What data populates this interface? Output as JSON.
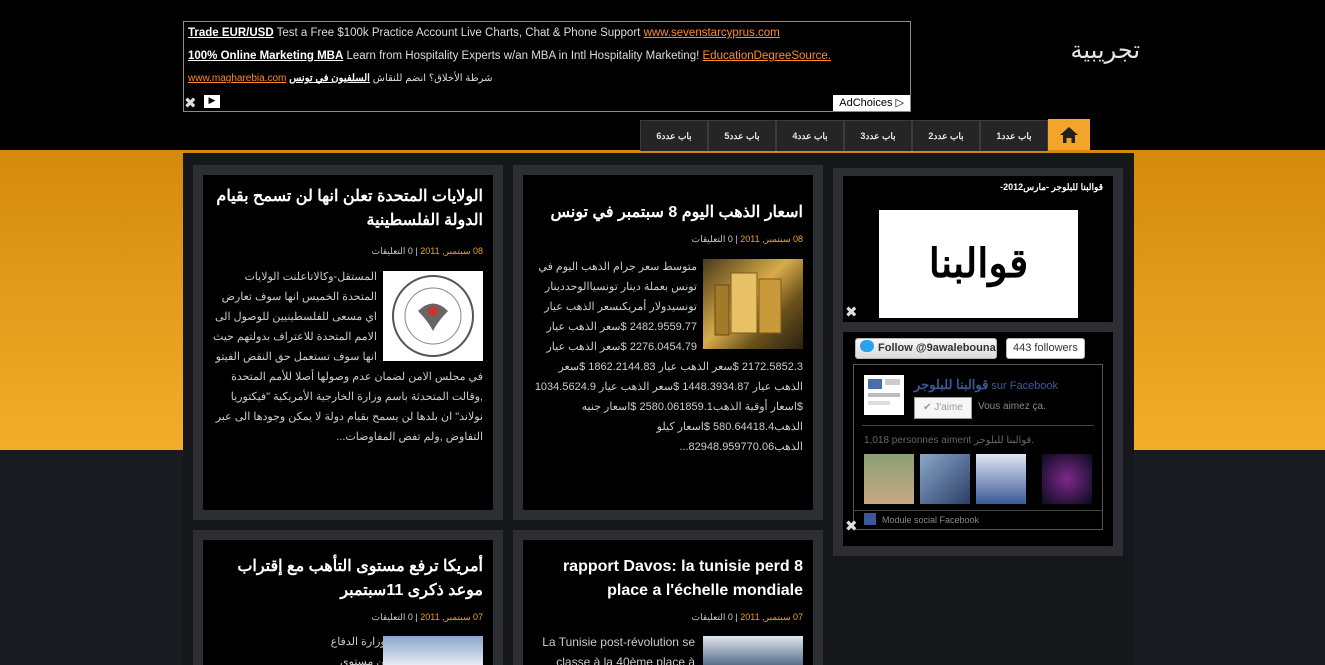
{
  "site": {
    "title": "تجريبية"
  },
  "ad": {
    "line1": {
      "title": "Trade EUR/USD",
      "text": " Test a Free $100k Practice Account Live Charts, Chat & Phone Support ",
      "url": "www.sevenstarcyprus.com"
    },
    "line2": {
      "title": "100% Online Marketing MBA",
      "text": " Learn from Hospitality Experts w/an MBA in Intl Hospitality Marketing! ",
      "url": "EducationDegreeSource."
    },
    "line3": {
      "title": "السلفيون في تونس",
      "text": " شرطة الأخلاق؟ انضم للنقاش ",
      "url": "www.magharebia.com"
    },
    "choices": "AdChoices ▷",
    "arrow": "▶"
  },
  "nav": {
    "home_icon": "home-icon",
    "tabs": [
      "باب عدد1",
      "باب عدد2",
      "باب عدد3",
      "باب عدد4",
      "باب عدد5",
      "باب عدد6"
    ]
  },
  "posts": [
    {
      "title": "الولايات المتحدة تعلن انها لن تسمح بقيام الدولة الفلسطينية",
      "date": "08 سبتمبر, 2011",
      "comments": "| 0 التعليقات",
      "thumb_text": "State of PALESTINE",
      "body": "المستقل-وكالاتاعلنت الولايات المتحدة الخميس انها سوف تعارض اي مسعى للفلسطينيين للوصول الى الامم المتحدة للاعتراف بدولتهم حيث انها سوف تستعمل حق النقض الفيتو في مجلس الامن لضمان عدم وصولها أصلا للأمم المتحدة ,وقالت المتحدثة باسم وزارة الخارجية الأمريكية \"فيكتوريا نولاند\" ان بلدها لن يسمح بقيام دولة لا يمكن وجودها الى عبر التفاوض ,ولم تفض المفاوضات..."
    },
    {
      "title": "اسعار الذهب اليوم 8 سبتمبر في تونس",
      "date": "08 سبتمبر, 2011",
      "comments": "| 0 التعليقات",
      "body": "متوسط سعر جرام الذهب اليوم في تونس بعملة دينار تونسياالوحددينار تونسيدولار أمريكىسعر الذهب عيار 2482.9559.77 $سعر الذهب عيار 2276.0454.79 $سعر الذهب عيار 2172.5852.3 $سعر الذهب عيار 1862.2144.83 $سعر الذهب عيار 1448.3934.87 $سعر الذهب عيار 1034.5624.9 $اسعار أوقية الذهب2580.061859.1 $اسعار جنيه الذهب580.64418.4 $اسعار كيلو الذهب82948.959770.06..."
    },
    {
      "title": "أمريكا ترفع مستوى التأهب مع إقتراب موعد ذكرى 11سبتمبر",
      "date": "07 سبتمبر, 2011",
      "comments": "| 0 التعليقات",
      "body": "المستقل-وكالاترفعت وزارة الدفاع الأمريكية (البنتاغون) من مستوى"
    },
    {
      "title": "rapport Davos: la tunisie perd 8 place a l'échelle mondiale",
      "date": "07 سبتمبر, 2011",
      "comments": "| 0 التعليقات",
      "body": "La Tunisie post-révolution se classe à la 40ème place à"
    }
  ],
  "sidebar": {
    "widget1": {
      "title": "قوالبنا للبلوجر -مارس2012-",
      "image_text": "قوالبنا للبلوجر"
    },
    "twitter": {
      "button": "Follow @9awalebouna",
      "count": "443 followers"
    },
    "facebook": {
      "page_name": "قوالبنا للبلوجر",
      "on": " sur Facebook",
      "like": "✔ J'aime",
      "aime": "Vous aimez ça.",
      "count": "1,018 personnes aiment قوالبنا للبلوجر.",
      "footer": "Module social Facebook",
      "faces": [
        "face-1",
        "face-2",
        "face-3",
        "face-4"
      ]
    }
  }
}
